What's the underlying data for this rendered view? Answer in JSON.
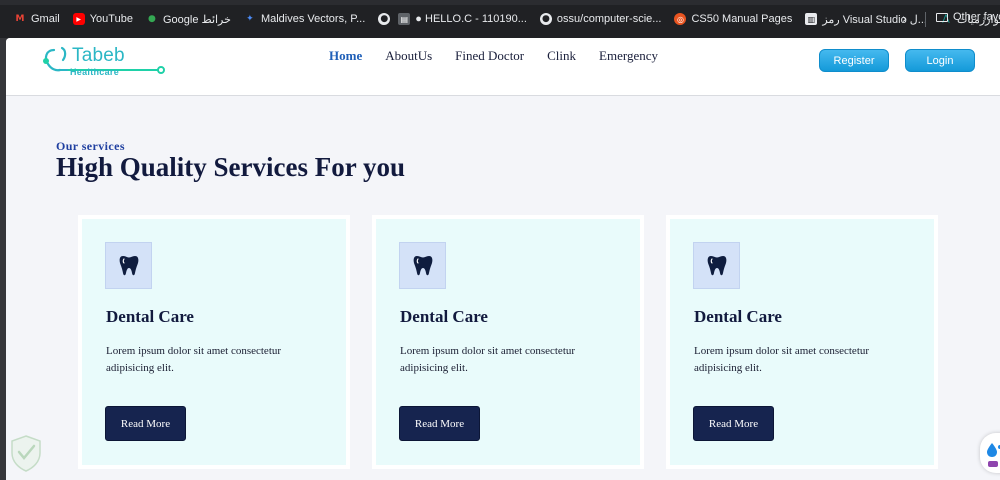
{
  "bookmarks": [
    {
      "label": "Gmail",
      "icon": "gmail-icon"
    },
    {
      "label": "YouTube",
      "icon": "youtube-icon"
    },
    {
      "label": "Google خرائط",
      "icon": "google-maps-icon"
    },
    {
      "label": "Maldives Vectors, P...",
      "icon": "vector-icon"
    },
    {
      "label": "",
      "icon": "github-icon"
    },
    {
      "label": "● HELLO.C - 110190...",
      "icon": "document-icon"
    },
    {
      "label": "ossu/computer-scie...",
      "icon": "github-icon"
    },
    {
      "label": "CS50 Manual Pages",
      "icon": "ubuntu-icon"
    },
    {
      "label": "رمز Visual Studio ل...",
      "icon": "visual-studio-icon"
    },
    {
      "label": "الخوارزميات",
      "icon": "algorithm-icon"
    }
  ],
  "other_bookmarks": "Other favor",
  "brand": {
    "name": "Tabeb",
    "tagline": "Healthcare",
    "color": "#2bb7c5"
  },
  "nav": [
    "Home",
    "AboutUs",
    "Fined Doctor",
    "Clink",
    "Emergency"
  ],
  "auth": {
    "register": "Register",
    "login": "Login"
  },
  "section": {
    "eyebrow": "Our services",
    "headline": "High Quality Services For you"
  },
  "cards": [
    {
      "title": "Dental Care",
      "description": "Lorem ipsum dolor sit amet consectetur adipisicing elit.",
      "button": "Read More",
      "icon": "tooth-icon"
    },
    {
      "title": "Dental Care",
      "description": "Lorem ipsum dolor sit amet consectetur adipisicing elit.",
      "button": "Read More",
      "icon": "tooth-icon"
    },
    {
      "title": "Dental Care",
      "description": "Lorem ipsum dolor sit amet consectetur adipisicing elit.",
      "button": "Read More",
      "icon": "tooth-icon"
    }
  ],
  "colors": {
    "primary_dark": "#16244f",
    "accent_blue": "#149ad9",
    "card_bg": "#e9fbfb",
    "page_bg": "#f4f5f9"
  }
}
